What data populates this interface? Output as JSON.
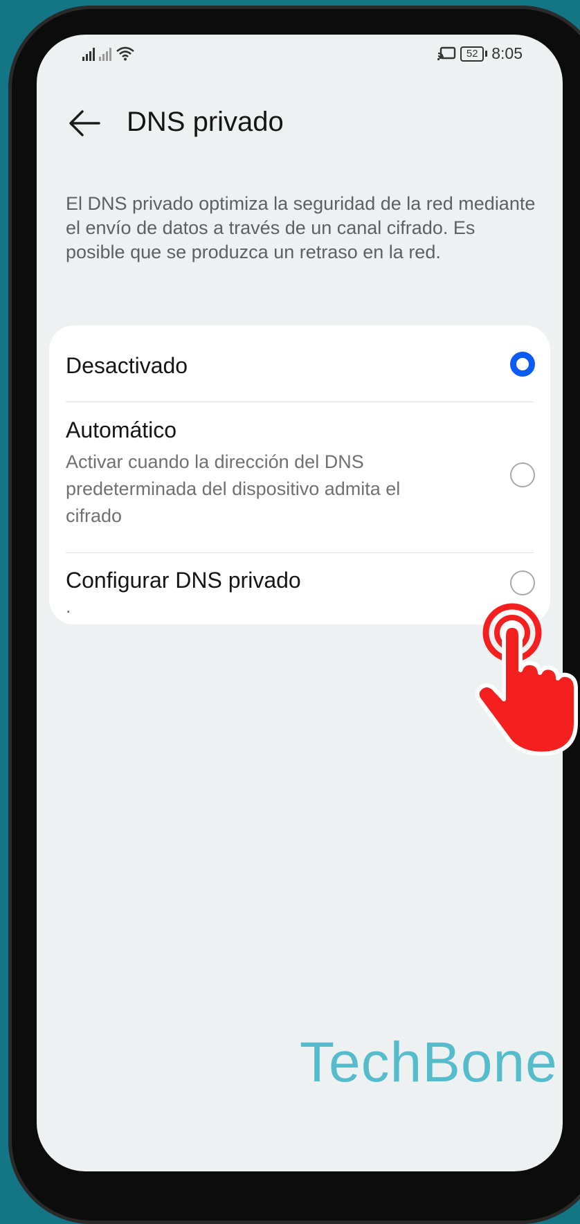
{
  "status_bar": {
    "time": "8:05",
    "battery": "52",
    "icons": [
      "signal-icon",
      "signal-off-icon",
      "wifi-icon",
      "screen-cast-icon",
      "battery-icon"
    ]
  },
  "header": {
    "title": "DNS privado",
    "back_icon": "back-arrow-icon"
  },
  "description": "El DNS privado optimiza la seguridad de la red mediante el envío de datos a través de un canal cifrado. Es posible que se produzca un retraso en la red.",
  "options": [
    {
      "label": "Desactivado",
      "subtitle": "",
      "selected": true
    },
    {
      "label": "Automático",
      "subtitle": "Activar cuando la dirección del DNS predeterminada del dispositivo admita el cifrado",
      "selected": false
    },
    {
      "label": "Configurar DNS privado",
      "subtitle": ".",
      "selected": false
    }
  ],
  "watermark": "TechBone",
  "colors": {
    "background": "#147684",
    "screen": "#eef1f2",
    "accent": "#0a5cf5",
    "tap_hand": "#f41f1f",
    "watermark": "#55bccb"
  }
}
